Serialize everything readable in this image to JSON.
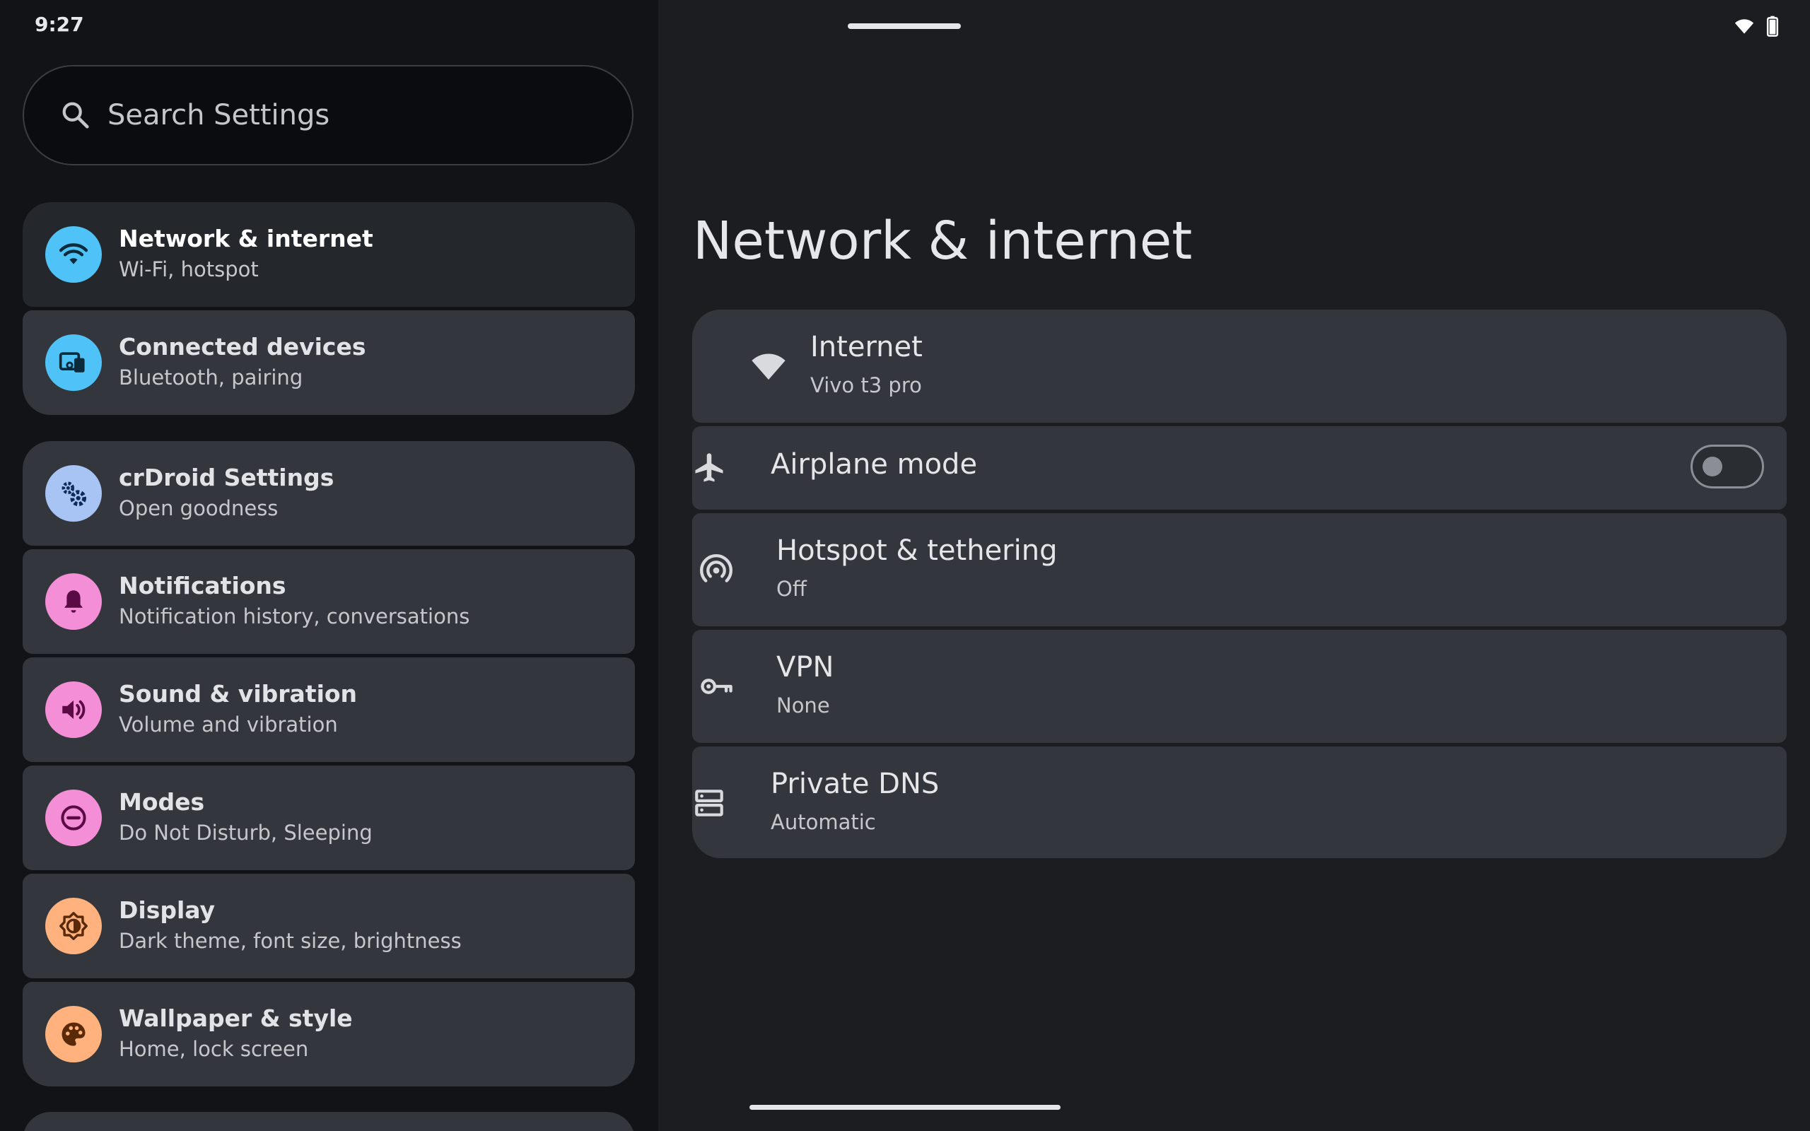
{
  "status_bar": {
    "time": "9:27"
  },
  "search": {
    "placeholder": "Search Settings"
  },
  "sidebar": {
    "items": [
      {
        "label": "Network & internet",
        "summary": "Wi-Fi, hotspot",
        "icon": "wifi-icon",
        "color": "#4fc3f7",
        "selected": true
      },
      {
        "label": "Connected devices",
        "summary": "Bluetooth, pairing",
        "icon": "devices-icon",
        "color": "#4fc3f7"
      },
      {
        "label": "crDroid Settings",
        "summary": "Open goodness",
        "icon": "gears-icon",
        "color": "#a8c4f5"
      },
      {
        "label": "Notifications",
        "summary": "Notification history, conversations",
        "icon": "bell-icon",
        "color": "#f48fd7"
      },
      {
        "label": "Sound & vibration",
        "summary": "Volume and vibration",
        "icon": "speaker-icon",
        "color": "#f48fd7"
      },
      {
        "label": "Modes",
        "summary": "Do Not Disturb, Sleeping",
        "icon": "do-not-disturb-icon",
        "color": "#f48fd7"
      },
      {
        "label": "Display",
        "summary": "Dark theme, font size, brightness",
        "icon": "brightness-icon",
        "color": "#ffb27d"
      },
      {
        "label": "Wallpaper & style",
        "summary": "Home, lock screen",
        "icon": "palette-icon",
        "color": "#ffb27d"
      }
    ]
  },
  "main": {
    "title": "Network & internet",
    "rows": [
      {
        "title": "Internet",
        "summary": "Vivo t3 pro",
        "icon": "wifi-icon"
      },
      {
        "title": "Airplane mode",
        "icon": "airplane-icon",
        "toggle": false
      },
      {
        "title": "Hotspot & tethering",
        "summary": "Off",
        "icon": "hotspot-icon"
      },
      {
        "title": "VPN",
        "summary": "None",
        "icon": "key-icon"
      },
      {
        "title": "Private DNS",
        "summary": "Automatic",
        "icon": "dns-icon"
      }
    ]
  }
}
